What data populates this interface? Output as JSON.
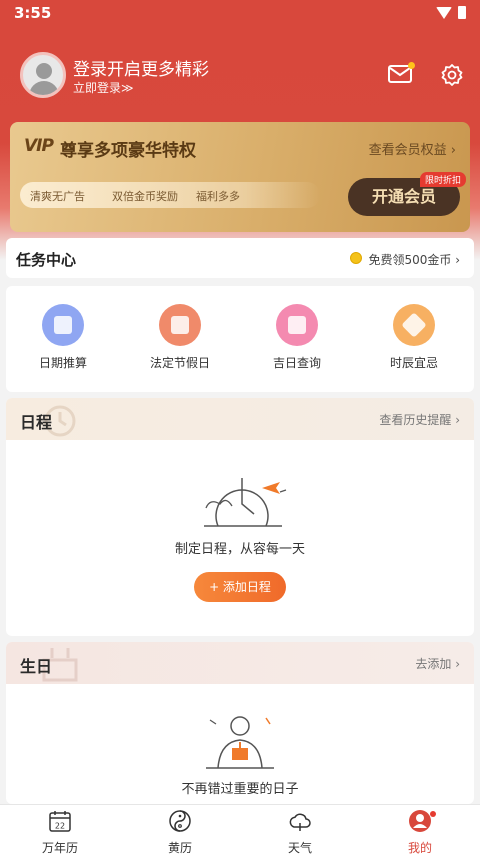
{
  "status_bar": {
    "time": "3:55"
  },
  "profile": {
    "title": "登录开启更多精彩",
    "subtitle": "立即登录≫"
  },
  "vip": {
    "logo": "VIP",
    "title": "尊享多项豪华特权",
    "benefits_link": "查看会员权益 ›",
    "features": [
      "清爽无广告",
      "双倍金币奖励",
      "福利多多"
    ],
    "open_button": "开通会员",
    "discount_badge": "限时折扣",
    "colors": {
      "card": "#d9ae6a",
      "button": "#4a3324"
    }
  },
  "task_center": {
    "title": "任务中心",
    "reward": "免费领500金币 ›"
  },
  "tools": [
    {
      "label": "日期推算",
      "icon": "calendar-calc-icon",
      "color": "#8fa6f2"
    },
    {
      "label": "法定节假日",
      "icon": "holiday-lantern-icon",
      "color": "#f08a6a"
    },
    {
      "label": "吉日查询",
      "icon": "lucky-day-icon",
      "color": "#f48ab0"
    },
    {
      "label": "时辰宜忌",
      "icon": "hour-fortune-icon",
      "color": "#f7b062"
    }
  ],
  "schedule": {
    "title": "日程",
    "history_link": "查看历史提醒 ›",
    "empty_text": "制定日程，从容每一天",
    "add_button": "+ 添加日程"
  },
  "birthday": {
    "title": "生日",
    "add_link": "去添加 ›",
    "empty_text": "不再错过重要的日子"
  },
  "tabs": [
    {
      "label": "万年历",
      "icon": "calendar-icon",
      "badge": "22"
    },
    {
      "label": "黄历",
      "icon": "yin-yang-icon"
    },
    {
      "label": "天气",
      "icon": "weather-icon"
    },
    {
      "label": "我的",
      "icon": "profile-icon",
      "active": true
    }
  ],
  "theme": {
    "primary": "#d8483c",
    "accent": "#f06a2a"
  }
}
